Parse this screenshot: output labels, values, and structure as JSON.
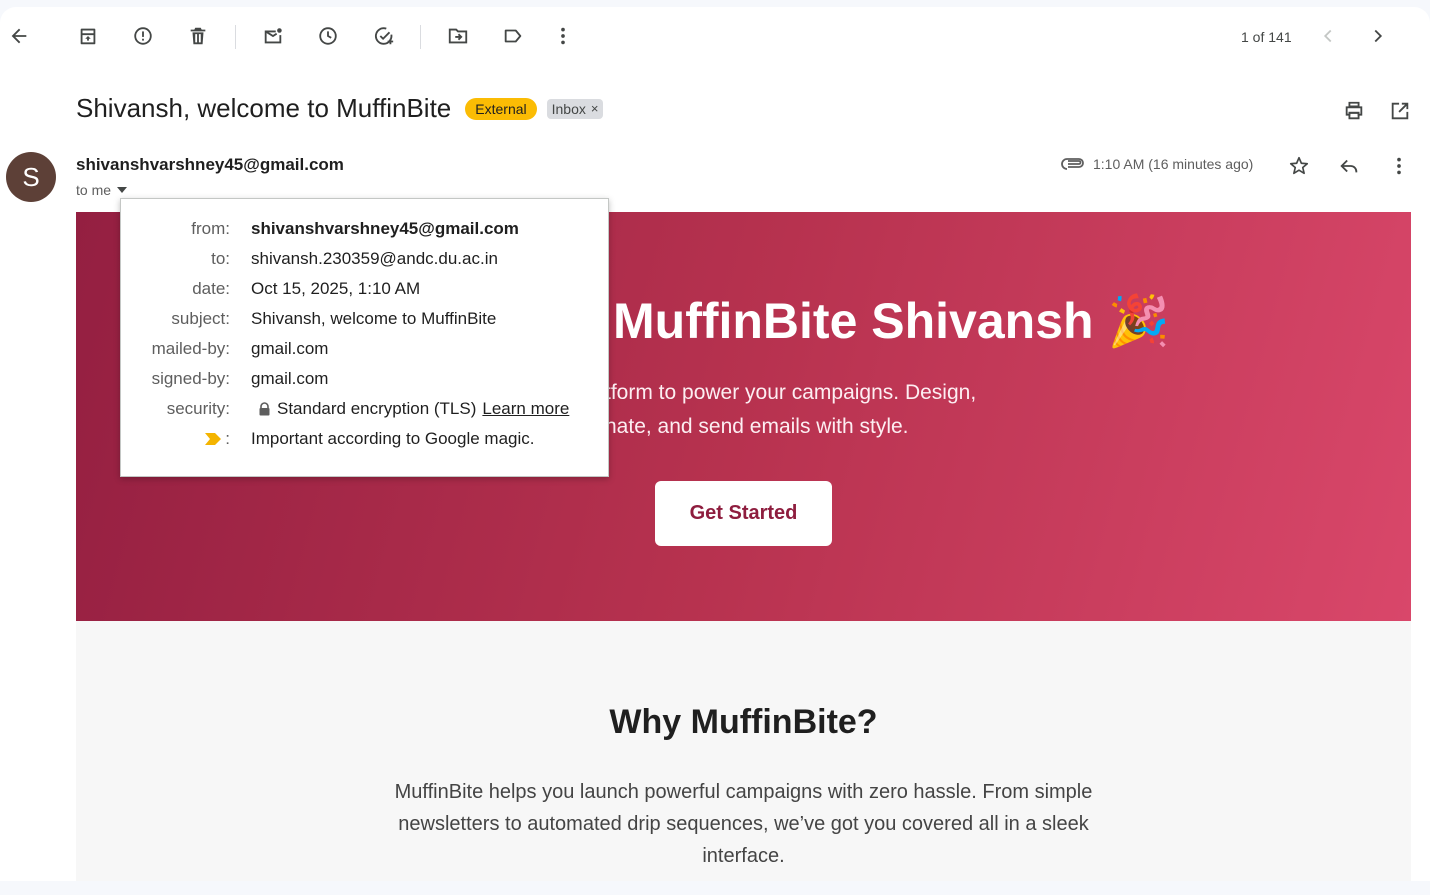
{
  "toolbar": {
    "back": "arrow-back-icon",
    "archive": "archive-icon",
    "spam": "report-spam-icon",
    "delete": "delete-icon",
    "unread": "mark-unread-icon",
    "snooze": "snooze-icon",
    "task": "add-task-icon",
    "move": "move-to-icon",
    "label": "label-icon",
    "more": "more-vert-icon"
  },
  "pager": {
    "text": "1 of 141"
  },
  "email": {
    "subject": "Shivansh, welcome to MuffinBite",
    "badge_external": "External",
    "badge_inbox": "Inbox",
    "badge_close": "×",
    "avatar_letter": "S",
    "sender": "shivanshvarshney45@gmail.com",
    "to_me": "to me",
    "time": "1:10 AM (16 minutes ago)"
  },
  "details": {
    "rows": [
      {
        "label": "from:",
        "value": "shivanshvarshney45@gmail.com"
      },
      {
        "label": "to:",
        "value": "shivansh.230359@andc.du.ac.in"
      },
      {
        "label": "date:",
        "value": "Oct 15, 2025, 1:10 AM"
      },
      {
        "label": "subject:",
        "value": "Shivansh, welcome to MuffinBite"
      },
      {
        "label": "mailed-by:",
        "value": "gmail.com"
      },
      {
        "label": "signed-by:",
        "value": "gmail.com"
      },
      {
        "label": "security:",
        "value": "Standard encryption (TLS)",
        "link": "Learn more"
      },
      {
        "label": ":",
        "value": "Important according to Google magic."
      }
    ]
  },
  "hero": {
    "title": "MuffinBite Shivansh 🎉",
    "line1": "tform to power your campaigns. Design,",
    "line2": "nate, and send emails with style.",
    "cta": "Get Started"
  },
  "why": {
    "title": "Why MuffinBite?",
    "text": "MuffinBite helps you launch powerful campaigns with zero hassle. From simple newsletters to automated drip sequences, we’ve got you covered all in a sleek interface."
  },
  "colors": {
    "hero_start": "#941f41",
    "hero_end": "#d9476a",
    "badge_external": "#fbbc04",
    "cta_text": "#8e1d3e"
  }
}
